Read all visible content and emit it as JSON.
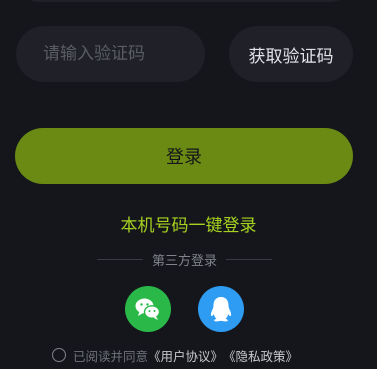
{
  "form": {
    "code_placeholder": "请输入验证码",
    "get_code_label": "获取验证码",
    "login_label": "登录",
    "one_click_label": "本机号码一键登录"
  },
  "third_party": {
    "divider_label": "第三方登录",
    "providers": [
      {
        "name": "WeChat",
        "icon": "wechat-icon",
        "color": "#2ab948"
      },
      {
        "name": "QQ",
        "icon": "qq-icon",
        "color": "#2e9cf2"
      }
    ]
  },
  "agreement": {
    "prefix": "已阅读并同意",
    "user_agreement": "《用户协议》",
    "privacy_policy": "《隐私政策》"
  },
  "colors": {
    "background": "#15161c",
    "field": "#1f2028",
    "accent": "#6b8a13",
    "accent_text": "#a6d21f"
  }
}
